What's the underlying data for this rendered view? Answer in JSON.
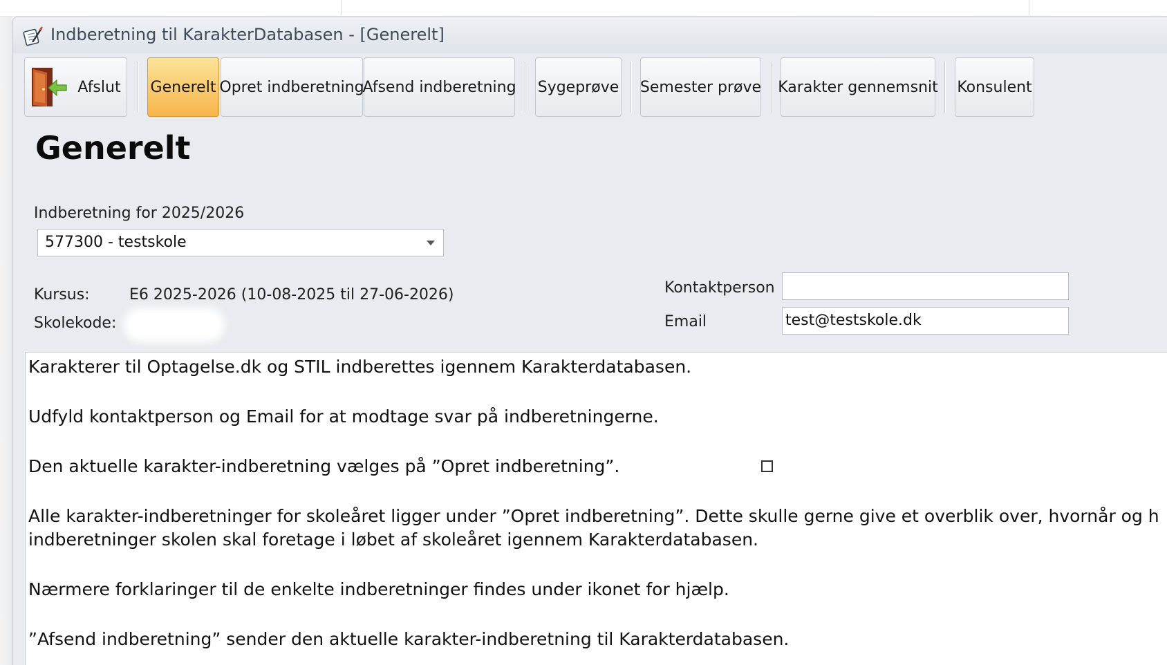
{
  "window": {
    "title": "Indberetning til KarakterDatabasen - [Generelt]"
  },
  "toolbar": {
    "afslut": "Afslut",
    "generelt": "Generelt",
    "opret": "Opret indberetning",
    "afsend": "Afsend indberetning",
    "sygeprove": "Sygeprøve",
    "semester": "Semester prøve",
    "karakter_gennemsnit": "Karakter gennemsnit",
    "konsulent": "Konsulent",
    "active_tab": "Generelt"
  },
  "page": {
    "heading": "Generelt",
    "indberetning_label": "Indberetning for 2025/2026",
    "school_select_value": "577300 - testskole",
    "kursus_label": "Kursus:",
    "kursus_value": "E6 2025-2026  (10-08-2025 til 27-06-2026)",
    "skolekode_label": "Skolekode:",
    "kontaktperson_label": "Kontaktperson",
    "email_label": "Email",
    "email_value": "test@testskole.dk"
  },
  "info_text": {
    "p1": "Karakterer til Optagelse.dk og STIL indberettes igennem Karakterdatabasen.",
    "p2": "Udfyld kontaktperson og Email for at modtage svar på indberetningerne.",
    "p3": "Den aktuelle karakter-indberetning vælges på ”Opret indberetning”.",
    "p4a": "Alle karakter-indberetninger for skoleåret ligger under ”Opret indberetning”. Dette skulle gerne give et overblik over, hvornår og h",
    "p4b": "indberetninger skolen skal foretage i løbet af skoleåret igennem Karakterdatabasen.",
    "p5": "Nærmere forklaringer til de enkelte indberetninger findes under ikonet for hjælp.",
    "p6": "”Afsend indberetning”  sender den aktuelle karakter-indberetning til Karakterdatabasen."
  },
  "colors": {
    "active_button": "#f7b54a",
    "window_bg": "#e8ebef"
  },
  "icons": {
    "app": "pen-notepad-icon",
    "exit": "exit-door-icon"
  }
}
